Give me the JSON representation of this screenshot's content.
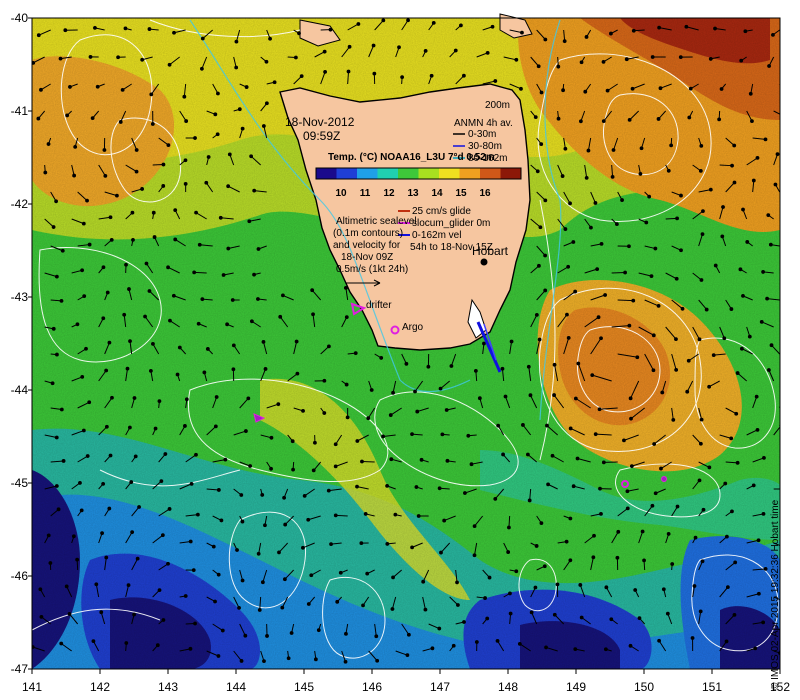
{
  "map": {
    "date": "18-Nov-2012",
    "time": "09:59Z",
    "colorbar": {
      "title": "Temp. (°C) NOAA16_L3U 7°d 0.52m",
      "ticks": [
        "10",
        "11",
        "12",
        "13",
        "14",
        "15",
        "16"
      ],
      "colors": [
        "#1a0a8c",
        "#1f3fd6",
        "#1fa0e8",
        "#20d0b0",
        "#3ec83a",
        "#a8e020",
        "#f0e020",
        "#f0a020",
        "#d05818",
        "#8c1808"
      ]
    },
    "anmn": {
      "depth": "200m",
      "title": "ANMN 4h av.",
      "items": [
        "0-30m",
        "30-80m",
        "80-162m"
      ]
    },
    "glider": {
      "items": [
        "25 cm/s glide",
        "slocum_glider 0m",
        "0-162m vel",
        "54h to 18-Nov 15Z"
      ]
    },
    "altimetry": {
      "lines": [
        "Altimetric sealevel",
        "(0.1m contours)",
        "and velocity for",
        "18-Nov 09Z",
        "0.5m/s (1kt 24h)"
      ]
    },
    "places": {
      "hobart": "Hobart",
      "drifter": "drifter",
      "argo": "Argo"
    },
    "x_ticks": [
      "141",
      "142",
      "143",
      "144",
      "145",
      "146",
      "147",
      "148",
      "149",
      "150",
      "151",
      "152"
    ],
    "y_ticks": [
      "-40",
      "-41",
      "-42",
      "-43",
      "-44",
      "-45",
      "-46",
      "-47"
    ],
    "credit": "© IMOS 02-Apr-2015 19:32:36 Hobart time",
    "colors": {
      "land": "#f6c6a0",
      "deep": "#16137a",
      "cold": "#1f6fe0",
      "cool": "#20b0d8",
      "mild": "#30c880",
      "green": "#3cc838",
      "yellow": "#d8e028",
      "warm": "#f0a020",
      "hot": "#c84818"
    }
  }
}
